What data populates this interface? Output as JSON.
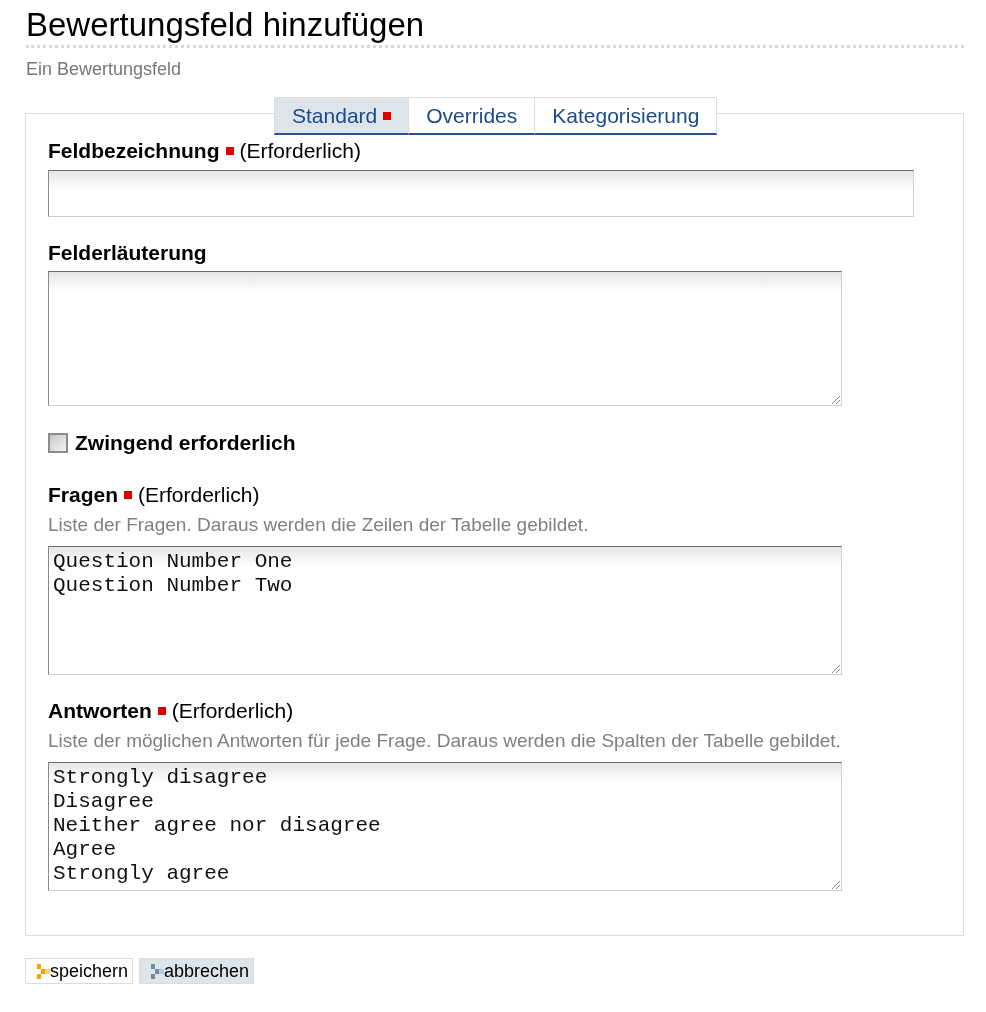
{
  "page": {
    "title": "Bewertungsfeld hinzufügen",
    "subtitle": "Ein Bewertungsfeld"
  },
  "tabs": [
    {
      "label": "Standard",
      "selected": true,
      "flagged": true
    },
    {
      "label": "Overrides",
      "selected": false,
      "flagged": false
    },
    {
      "label": "Kategorisierung",
      "selected": false,
      "flagged": false
    }
  ],
  "fields": [
    {
      "kind": "text",
      "label": "Feldbezeichnung",
      "required": true,
      "required_note": "(Erforderlich)"
    },
    {
      "kind": "textarea",
      "label": "Felderläuterung",
      "required": false
    },
    {
      "kind": "checkbox",
      "label": "Zwingend erforderlich",
      "checked": false
    },
    {
      "kind": "textarea",
      "label": "Fragen",
      "required": true,
      "required_note": "(Erforderlich)",
      "help": "Liste der Fragen. Daraus werden die Zeilen der Tabelle gebildet.",
      "value": "Question Number One\nQuestion Number Two"
    },
    {
      "kind": "textarea",
      "label": "Antworten",
      "required": true,
      "required_note": "(Erforderlich)",
      "help": "Liste der möglichen Antworten für jede Frage. Daraus werden die Spalten der Tabelle gebildet.",
      "value": "Strongly disagree\nDisagree\nNeither agree nor disagree\nAgree\nStrongly agree"
    }
  ],
  "buttons": [
    {
      "label": "speichern",
      "kind": "save"
    },
    {
      "label": "abbrechen",
      "kind": "cancel"
    }
  ]
}
